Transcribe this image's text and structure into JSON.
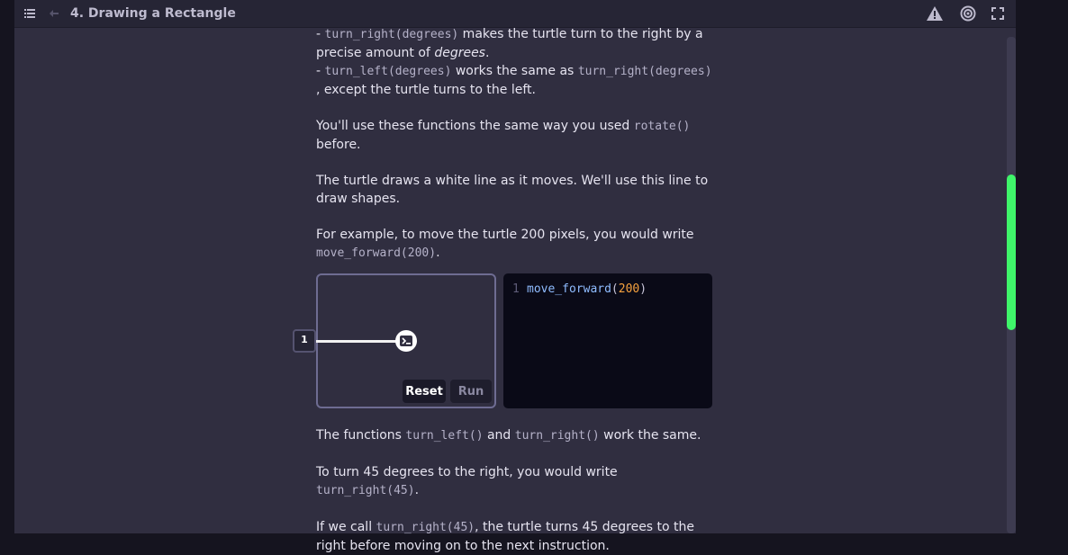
{
  "header": {
    "title": "4. Drawing a Rectangle",
    "icons": [
      "menu-icon",
      "back-icon",
      "warning-icon",
      "gear-icon",
      "expand-icon"
    ]
  },
  "lesson": {
    "p1": {
      "dash1": "- ",
      "code1": "turn_right(degrees)",
      "text1": " makes the turtle turn to the right by a precise amount of ",
      "em1": "degrees",
      "text1b": ".",
      "dash2": "- ",
      "code2": "turn_left(degrees)",
      "text2": " works the same as ",
      "code3": "turn_right(degrees)",
      "text3": ", except the turtle turns to the left."
    },
    "p2": {
      "text1": "You'll use these functions the same way you used ",
      "code1": "rotate()",
      "text2": " before."
    },
    "p3": "The turtle draws a white line as it moves. We'll use this line to draw shapes.",
    "p4": {
      "text1": "For example, to move the turtle 200 pixels, you would write ",
      "code1": "move_forward(200)",
      "text2": "."
    },
    "p5": {
      "text1": "The functions ",
      "code1": "turn_left()",
      "text2": " and ",
      "code2": "turn_right()",
      "text3": " work the same."
    },
    "p6": {
      "text1": "To turn 45 degrees to the right, you would write ",
      "code1": "turn_right(45)",
      "text2": "."
    },
    "p7": {
      "text1": "If we call ",
      "code1": "turn_right(45)",
      "text2": ", the turtle turns 45 degrees to the right before moving on to the next instruction."
    }
  },
  "demo": {
    "step_badge": "1",
    "reset_label": "Reset",
    "run_label": "Run",
    "editor": {
      "line_number": "1",
      "fn_name": "move_forward",
      "open_paren": "(",
      "arg": "200",
      "close_paren": ")"
    }
  },
  "colors": {
    "scrollbar_thumb": "#3ff56a",
    "code_function": "#8fbcff",
    "code_number": "#f7a23f",
    "canvas_border": "#6e6c92"
  }
}
